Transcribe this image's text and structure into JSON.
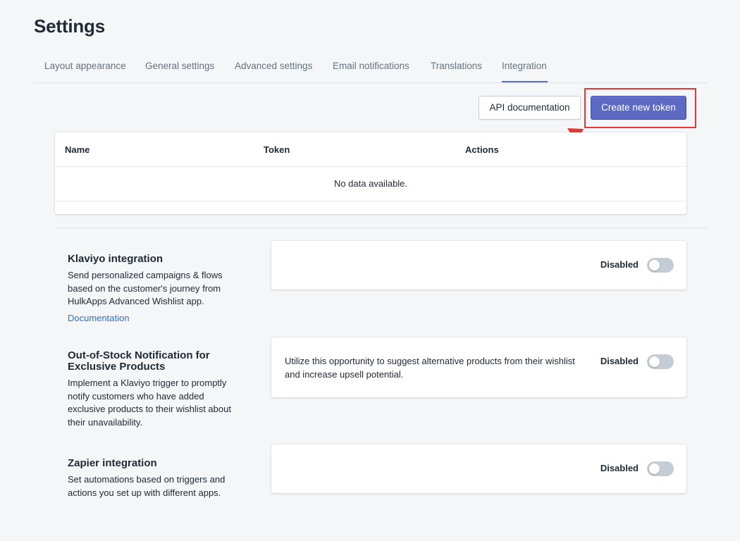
{
  "page": {
    "title": "Settings"
  },
  "tabs": [
    {
      "label": "Layout appearance"
    },
    {
      "label": "General settings"
    },
    {
      "label": "Advanced settings"
    },
    {
      "label": "Email notifications"
    },
    {
      "label": "Translations"
    },
    {
      "label": "Integration",
      "active": true
    }
  ],
  "actions": {
    "api_docs_label": "API documentation",
    "create_token_label": "Create new token"
  },
  "tokens_table": {
    "columns": [
      "Name",
      "Token",
      "Actions"
    ],
    "rows": [],
    "empty_message": "No data available."
  },
  "integrations": [
    {
      "title": "Klaviyo integration",
      "description": "Send personalized campaigns & flows based on the customer's journey from HulkApps Advanced Wishlist app.",
      "link": "Documentation",
      "card_text": "",
      "status": "Disabled",
      "enabled": false
    },
    {
      "title": "Out-of-Stock Notification for Exclusive Products",
      "description": "Implement a Klaviyo trigger to promptly notify customers who have added exclusive products to their wishlist about their unavailability.",
      "card_text": "Utilize this opportunity to suggest alternative products from their wishlist and increase upsell potential.",
      "status": "Disabled",
      "enabled": false
    },
    {
      "title": "Zapier integration",
      "description": "Set automations based on triggers and actions you set up with different apps.",
      "card_text": "",
      "status": "Disabled",
      "enabled": false
    }
  ],
  "colors": {
    "accent": "#5c6ac4",
    "highlight": "#e53935",
    "link": "#2c6ecb",
    "toggle_off": "#c4cdd5"
  },
  "icons": {
    "annotation": "arrow-pointer-icon"
  }
}
